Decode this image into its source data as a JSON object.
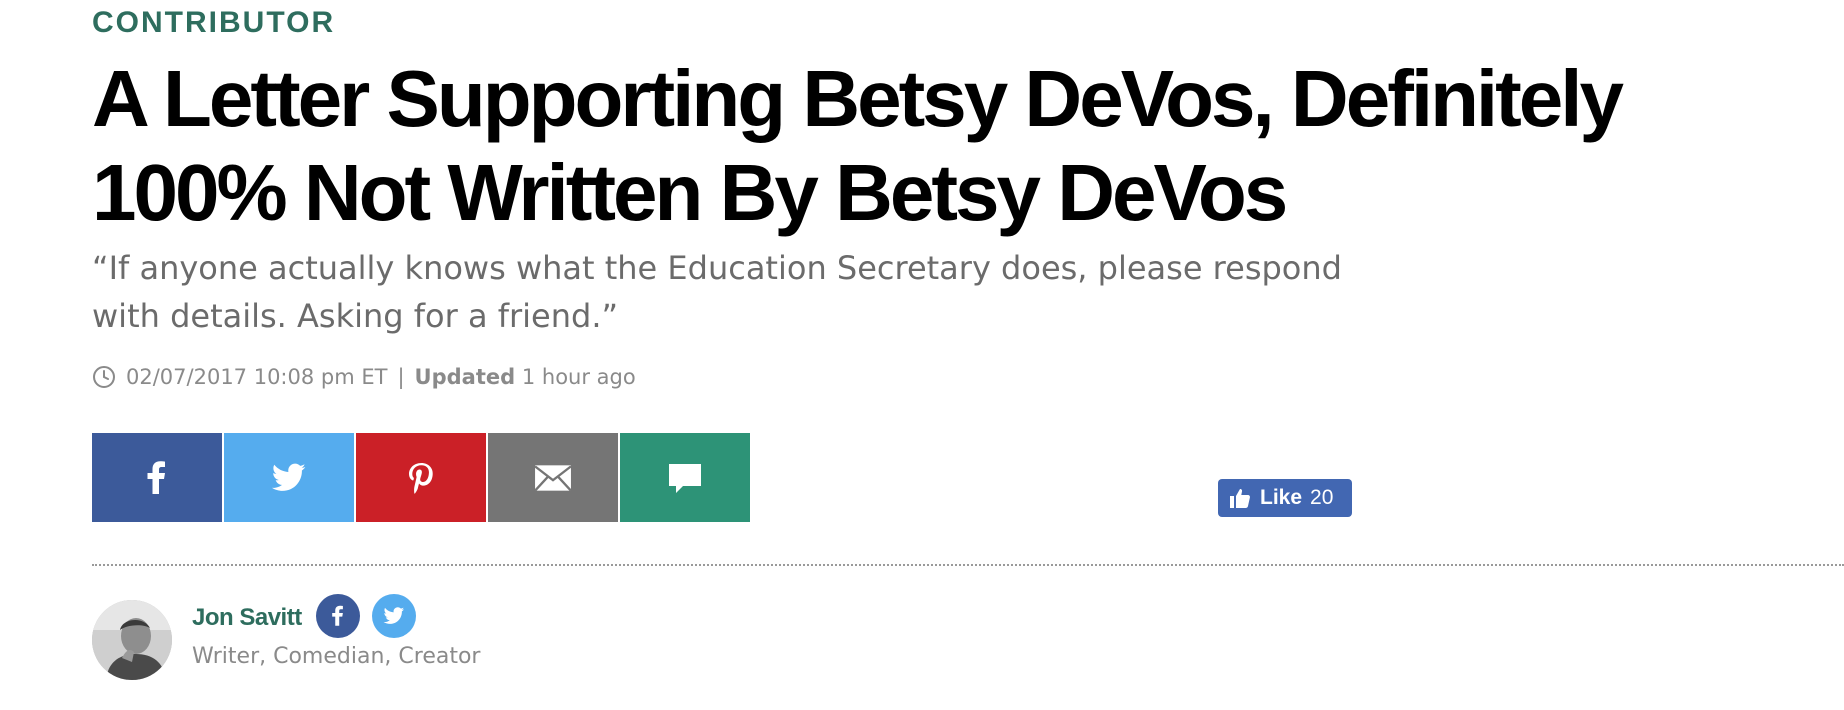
{
  "article": {
    "kicker": "CONTRIBUTOR",
    "headline": "A Letter Supporting Betsy DeVos, Definitely 100% Not Written By Betsy DeVos",
    "dek": "“If anyone actually knows what the Education Secretary does, please respond with details. Asking for a friend.”",
    "timestamp": {
      "icon": "clock-icon",
      "published": "02/07/2017 10:08 pm ET",
      "separator": "|",
      "updated_label": "Updated",
      "updated_value": "1 hour ago"
    }
  },
  "share": {
    "buttons": [
      {
        "name": "facebook",
        "icon": "facebook-icon",
        "color": "#3c5a9a"
      },
      {
        "name": "twitter",
        "icon": "twitter-icon",
        "color": "#55acee"
      },
      {
        "name": "pinterest",
        "icon": "pinterest-icon",
        "color": "#cb2027"
      },
      {
        "name": "email",
        "icon": "email-icon",
        "color": "#757575"
      },
      {
        "name": "comment",
        "icon": "comment-icon",
        "color": "#2d9377"
      }
    ]
  },
  "like": {
    "label": "Like",
    "count": "20",
    "icon": "thumbs-up-icon",
    "color": "#4267b2"
  },
  "author": {
    "name": "Jon Savitt",
    "bio": "Writer, Comedian, Creator",
    "social": [
      "facebook-icon",
      "twitter-icon"
    ]
  },
  "colors": {
    "accent_green": "#2e6d5e",
    "text_gray": "#6b6b6b"
  }
}
